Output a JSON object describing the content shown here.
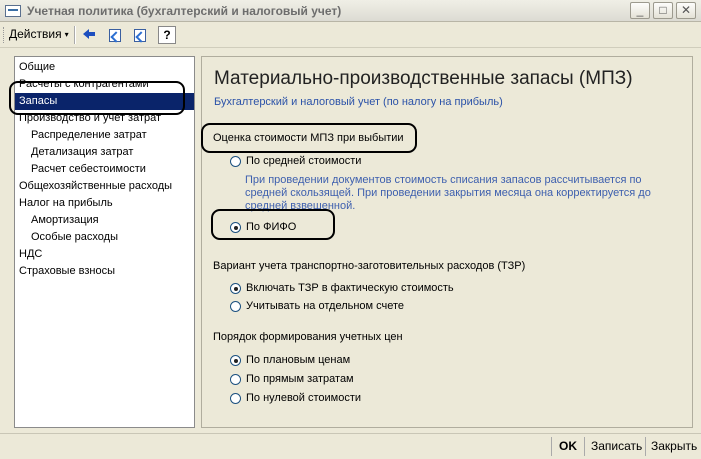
{
  "window": {
    "title": "Учетная политика (бухгалтерский и налоговый учет)",
    "minimize_glyph": "_",
    "maximize_glyph": "□",
    "close_glyph": "✕"
  },
  "toolbar": {
    "actions_label": "Действия",
    "actions_arrow": "▾",
    "help_label": "?",
    "icons": [
      "back-icon",
      "document-icon",
      "document-copy-icon",
      "help-icon"
    ]
  },
  "tree": {
    "items": [
      {
        "label": "Общие",
        "level": 0
      },
      {
        "label": "Расчеты с контрагентами",
        "level": 0
      },
      {
        "label": "Запасы",
        "level": 0,
        "selected": true
      },
      {
        "label": "Производство и учет затрат",
        "level": 0
      },
      {
        "label": "Распределение затрат",
        "level": 1
      },
      {
        "label": "Детализация затрат",
        "level": 1
      },
      {
        "label": "Расчет себестоимости",
        "level": 1
      },
      {
        "label": "Общехозяйственные расходы",
        "level": 0
      },
      {
        "label": "Налог на прибыль",
        "level": 0
      },
      {
        "label": "Амортизация",
        "level": 1
      },
      {
        "label": "Особые расходы",
        "level": 1
      },
      {
        "label": "НДС",
        "level": 0
      },
      {
        "label": "Страховые взносы",
        "level": 0
      }
    ]
  },
  "page": {
    "title": "Материально-производственные запасы (МПЗ)",
    "subtitle": "Бухгалтерский и налоговый учет (по налогу на прибыль)"
  },
  "valuation": {
    "label": "Оценка стоимости МПЗ при выбытии",
    "options": [
      {
        "label": "По средней стоимости",
        "checked": false
      },
      {
        "label": "По ФИФО",
        "checked": true
      }
    ],
    "hint": "При проведении документов стоимость списания запасов рассчитывается по средней скользящей. При проведении закрытия месяца она корректируется до средней взвешенной."
  },
  "tzr": {
    "label": "Вариант учета транспортно-заготовительных расходов (ТЗР)",
    "options": [
      {
        "label": "Включать ТЗР в фактическую стоимость",
        "checked": true
      },
      {
        "label": "Учитывать на отдельном счете",
        "checked": false
      }
    ]
  },
  "prices": {
    "label": "Порядок формирования учетных цен",
    "options": [
      {
        "label": "По плановым ценам",
        "checked": true
      },
      {
        "label": "По прямым затратам",
        "checked": false
      },
      {
        "label": "По нулевой стоимости",
        "checked": false
      }
    ]
  },
  "footer": {
    "ok_label": "OK",
    "save_label": "Записать",
    "close_label": "Закрыть"
  },
  "colors": {
    "selection": "#0a246a",
    "hint_text": "#3d5fae",
    "radio_checked": "#21a121"
  }
}
